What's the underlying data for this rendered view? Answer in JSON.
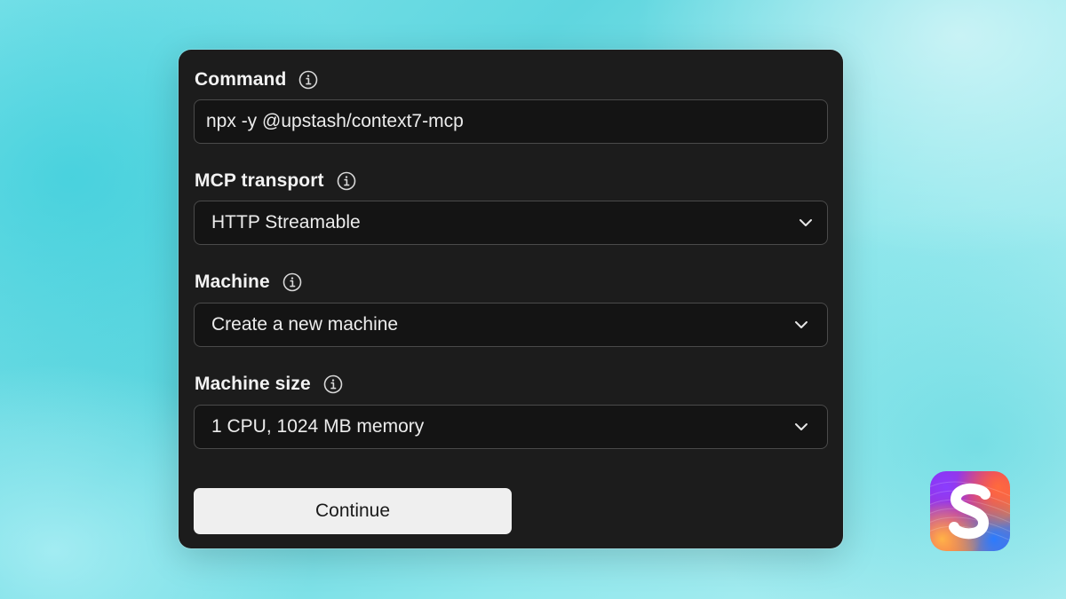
{
  "form": {
    "command": {
      "label": "Command",
      "value": "npx -y @upstash/context7-mcp"
    },
    "transport": {
      "label": "MCP transport",
      "selected": "HTTP Streamable"
    },
    "machine": {
      "label": "Machine",
      "selected": "Create a new machine"
    },
    "machine_size": {
      "label": "Machine size",
      "selected": "1 CPU, 1024 MB memory"
    },
    "continue_label": "Continue"
  },
  "icons": {
    "info": "info-circle-icon",
    "chevron": "chevron-down-icon",
    "logo": "app-logo-s"
  },
  "colors": {
    "panel_bg": "#1c1c1c",
    "field_bg": "#141414",
    "field_border": "#4a4a4a",
    "text": "#ececec",
    "button_bg": "#efefef",
    "button_text": "#1a1a1a",
    "background_accent": "#5fd6df"
  }
}
